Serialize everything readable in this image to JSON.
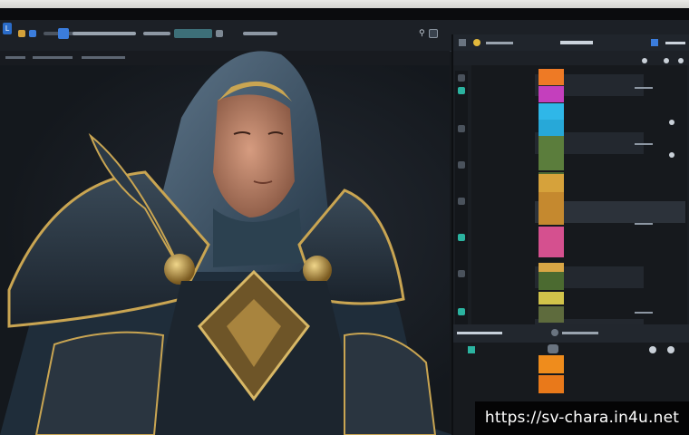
{
  "toolbar": {
    "logo": "L",
    "tabs": [
      "",
      "",
      "",
      "",
      ""
    ]
  },
  "subbar": {
    "items": [
      "",
      "",
      ""
    ]
  },
  "right_panel": {
    "header": [
      "",
      "",
      ""
    ],
    "swatches": [
      {
        "color": "#ee7a25"
      },
      {
        "color": "#c43fbd"
      },
      {
        "color": "#2fb7e8"
      },
      {
        "color": "#27a8d8"
      },
      {
        "color": "#5b7d3c"
      },
      {
        "color": "#4d6a33"
      },
      {
        "color": "#d6a23b"
      },
      {
        "color": "#c5892f"
      },
      {
        "color": "#d5508f"
      },
      {
        "color": "#d8a645"
      },
      {
        "color": "#4b6a30"
      },
      {
        "color": "#d1c34a"
      },
      {
        "color": "#5e6b3d"
      }
    ],
    "lower_swatches": [
      {
        "color": "#ef8c1c"
      },
      {
        "color": "#e9791a"
      }
    ],
    "divider_label": ""
  },
  "accent_colors": {
    "selection": "#3b7ddd",
    "teal_icon": "#2bb3a0",
    "gold_armor": "#c9a552"
  },
  "watermark": "https://sv-chara.in4u.net"
}
